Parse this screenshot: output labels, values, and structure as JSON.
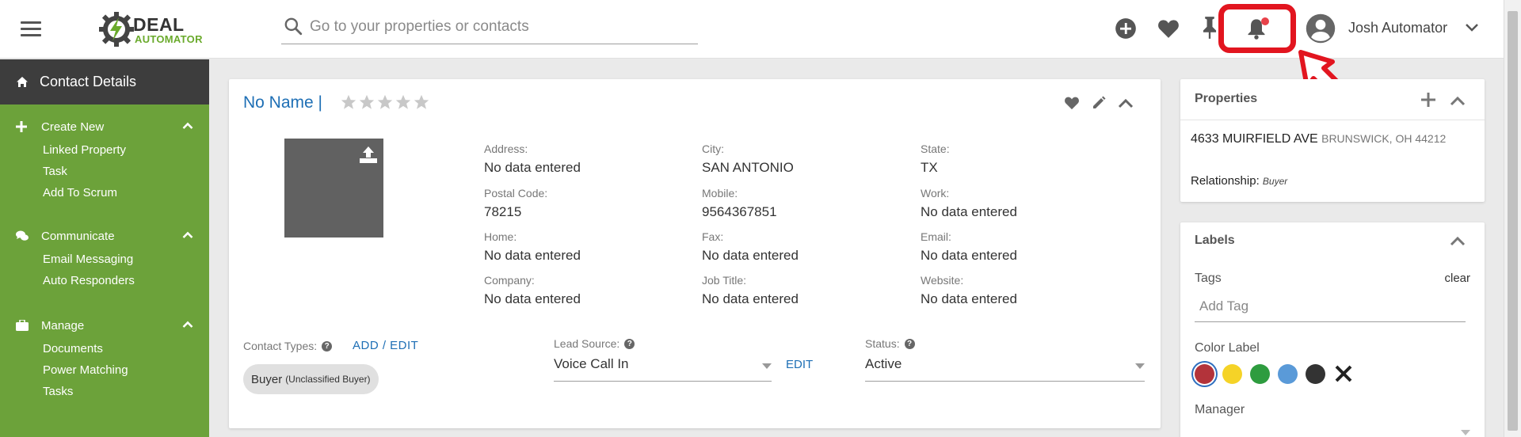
{
  "header": {
    "logo_word1": "DEAL",
    "logo_word2": "AUTOMATOR",
    "search_placeholder": "Go to your properties or contacts",
    "user_name": "Josh Automator",
    "icons": [
      "menu-icon",
      "add-circle-icon",
      "heart-icon",
      "pin-icon",
      "bell-icon",
      "user-avatar-icon",
      "chevron-down-icon"
    ],
    "notification_dot_color": "#e8424a",
    "highlight_color": "#e2151f"
  },
  "sidebar": {
    "title": "Contact Details",
    "sections": [
      {
        "title": "Create New",
        "items": [
          "Linked Property",
          "Task",
          "Add To Scrum"
        ]
      },
      {
        "title": "Communicate",
        "items": [
          "Email Messaging",
          "Auto Responders"
        ]
      },
      {
        "title": "Manage",
        "items": [
          "Documents",
          "Power Matching",
          "Tasks"
        ]
      }
    ]
  },
  "contact": {
    "name": "No Name |",
    "rating": 0,
    "fields": [
      {
        "label": "Address:",
        "value": "No data entered"
      },
      {
        "label": "City:",
        "value": "SAN ANTONIO"
      },
      {
        "label": "State:",
        "value": "TX"
      },
      {
        "label": "Postal Code:",
        "value": "78215"
      },
      {
        "label": "Mobile:",
        "value": "9564367851"
      },
      {
        "label": "Work:",
        "value": "No data entered"
      },
      {
        "label": "Home:",
        "value": "No data entered"
      },
      {
        "label": "Fax:",
        "value": "No data entered"
      },
      {
        "label": "Email:",
        "value": "No data entered"
      },
      {
        "label": "Company:",
        "value": "No data entered"
      },
      {
        "label": "Job Title:",
        "value": "No data entered"
      },
      {
        "label": "Website:",
        "value": "No data entered"
      }
    ],
    "contact_types_label": "Contact Types:",
    "add_edit_label": "ADD / EDIT",
    "contact_type_chip": "Buyer",
    "contact_type_chip_sub": "(Unclassified Buyer)",
    "lead_source_label": "Lead Source:",
    "lead_source_value": "Voice Call In",
    "lead_source_edit": "EDIT",
    "status_label": "Status:",
    "status_value": "Active"
  },
  "properties": {
    "title": "Properties",
    "address": "4633 MUIRFIELD AVE",
    "city": "BRUNSWICK, OH 44212",
    "relationship_label": "Relationship",
    "relationship_value": "Buyer"
  },
  "labels": {
    "title": "Labels",
    "tags_label": "Tags",
    "clear_label": "clear",
    "tag_placeholder": "Add Tag",
    "color_label": "Color Label",
    "colors": [
      "#b3333a",
      "#f5d327",
      "#2e9c3f",
      "#5a9ad8",
      "#333333"
    ],
    "selected_color": "#b3333a",
    "manager_label": "Manager"
  }
}
